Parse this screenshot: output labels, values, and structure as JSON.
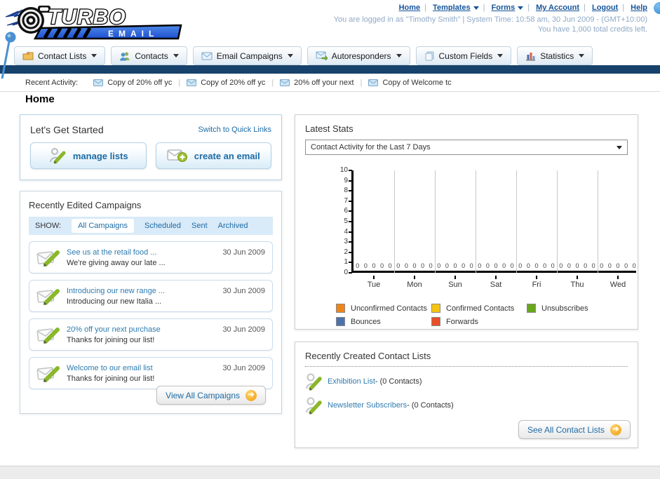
{
  "page": {
    "heading": "Home"
  },
  "header": {
    "logo": {
      "top": "TURBO",
      "bottom": "EMAIL"
    },
    "links": [
      {
        "label": "Home",
        "dropdown": false
      },
      {
        "label": "Templates",
        "dropdown": true
      },
      {
        "label": "Forms",
        "dropdown": true
      },
      {
        "label": "My Account",
        "dropdown": false
      },
      {
        "label": "Logout",
        "dropdown": false
      },
      {
        "label": "Help",
        "dropdown": false
      }
    ],
    "separator": "|",
    "login_line": "You are logged in as \"Timothy Smith\" | System Time: 10:58 am, 30 Jun 2009 - (GMT+10:00)",
    "credits_line": "You have 1,000 total credits left."
  },
  "nav_tabs": [
    {
      "label": "Contact Lists"
    },
    {
      "label": "Contacts"
    },
    {
      "label": "Email Campaigns"
    },
    {
      "label": "Autoresponders"
    },
    {
      "label": "Custom Fields"
    },
    {
      "label": "Statistics"
    }
  ],
  "recent_activity": {
    "label": "Recent Activity:",
    "items": [
      {
        "text": "Copy of 20% off yc"
      },
      {
        "text": "Copy of 20% off yc"
      },
      {
        "text": "20% off your next"
      },
      {
        "text": "Copy of Welcome tc"
      }
    ]
  },
  "get_started": {
    "title": "Let's Get Started",
    "switch_link": "Switch to Quick Links",
    "buttons": [
      {
        "label": "manage lists"
      },
      {
        "label": "create an email"
      }
    ]
  },
  "campaigns": {
    "title": "Recently Edited Campaigns",
    "show_label": "SHOW:",
    "filters": [
      {
        "label": "All Campaigns",
        "selected": true
      },
      {
        "label": "Scheduled",
        "selected": false
      },
      {
        "label": "Sent",
        "selected": false
      },
      {
        "label": "Archived",
        "selected": false
      }
    ],
    "rows": [
      {
        "title": "See us at the retail food ...",
        "subtitle": "We're giving away our late ...",
        "date": "30 Jun 2009"
      },
      {
        "title": "Introducing our new range ...",
        "subtitle": "Introducing our new Italia ...",
        "date": "30 Jun 2009"
      },
      {
        "title": "20% off your next purchase",
        "subtitle": "Thanks for joining our list!",
        "date": "30 Jun 2009"
      },
      {
        "title": "Welcome to our email list",
        "subtitle": "Thanks for joining our list!",
        "date": "30 Jun 2009"
      }
    ],
    "view_all_label": "View All Campaigns"
  },
  "stats": {
    "title": "Latest Stats",
    "dropdown_value": "Contact Activity for the Last 7 Days"
  },
  "chart_data": {
    "type": "bar",
    "title": "Contact Activity for the Last 7 Days",
    "categories": [
      "Tue",
      "Mon",
      "Sun",
      "Sat",
      "Fri",
      "Thu",
      "Wed"
    ],
    "series": [
      {
        "name": "Unconfirmed Contacts",
        "color": "#f08418",
        "values": [
          0,
          0,
          0,
          0,
          0,
          0,
          0
        ]
      },
      {
        "name": "Confirmed Contacts",
        "color": "#f6c40f",
        "values": [
          0,
          0,
          0,
          0,
          0,
          0,
          0
        ]
      },
      {
        "name": "Unsubscribes",
        "color": "#69a71c",
        "values": [
          0,
          0,
          0,
          0,
          0,
          0,
          0
        ]
      },
      {
        "name": "Bounces",
        "color": "#4c71ad",
        "values": [
          0,
          0,
          0,
          0,
          0,
          0,
          0
        ]
      },
      {
        "name": "Forwards",
        "color": "#e84f26",
        "values": [
          0,
          0,
          0,
          0,
          0,
          0,
          0
        ]
      }
    ],
    "ylim": [
      0,
      10
    ],
    "ytick_step": 1,
    "grid": "vertical-group-separators",
    "legend_position": "bottom"
  },
  "contact_lists": {
    "title": "Recently Created Contact Lists",
    "items": [
      {
        "name": "Exhibition List",
        "suffix": " - (0 Contacts)"
      },
      {
        "name": "Newsletter Subscribers",
        "suffix": " - (0 Contacts)"
      }
    ],
    "see_all_label": "See All Contact Lists"
  },
  "colors": {
    "navy_bar": "#17426b",
    "link_blue": "#1d6ba5",
    "muted_login_text": "#8fa9c6",
    "accent_orange": "#f0a01c",
    "show_bar_bg": "#d9eaf8"
  }
}
